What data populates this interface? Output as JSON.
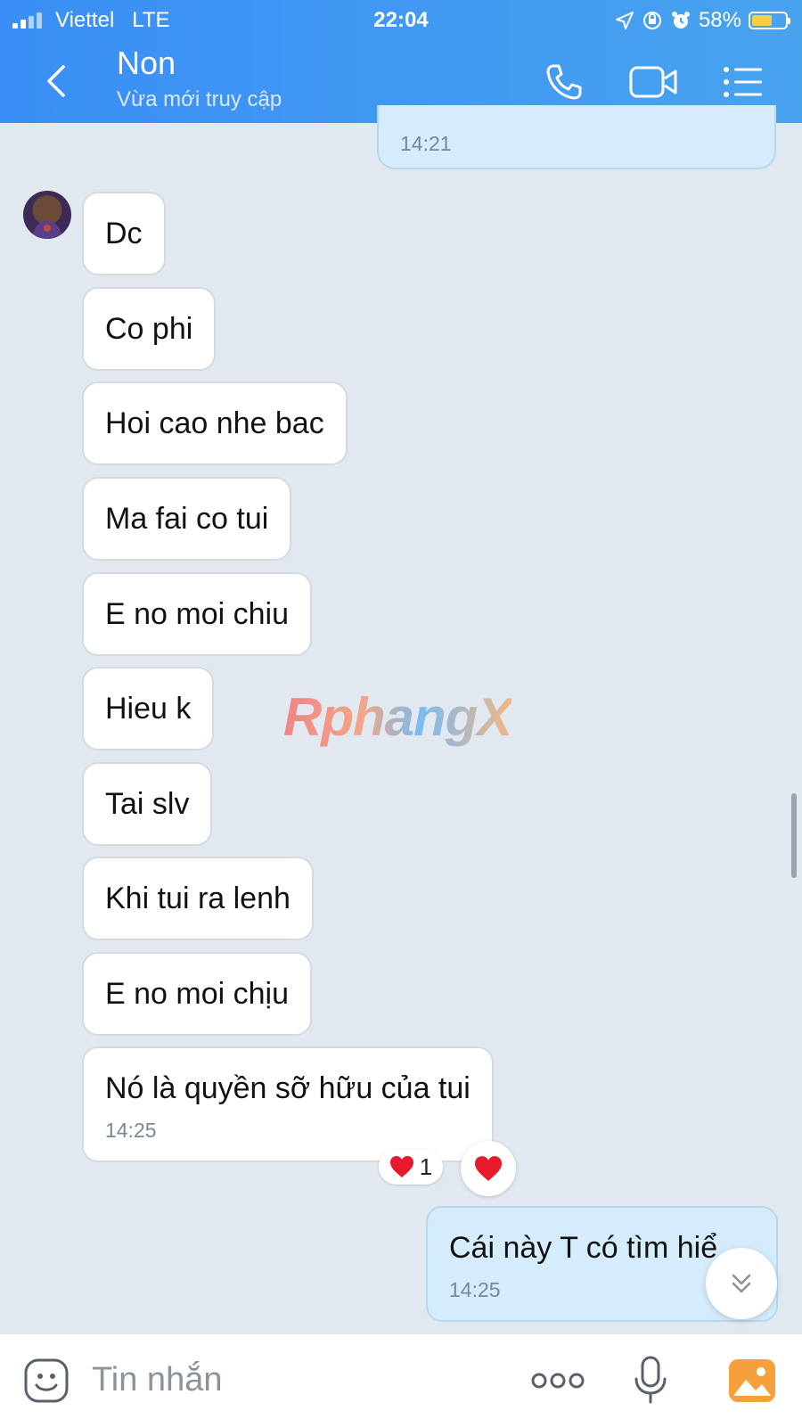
{
  "status_bar": {
    "carrier": "Viettel",
    "network": "LTE",
    "time": "22:04",
    "battery": "58%"
  },
  "header": {
    "contact_name": "Non",
    "contact_status": "Vừa mới truy cập",
    "icons": [
      "back-icon",
      "phone-icon",
      "video-icon",
      "menu-icon"
    ]
  },
  "chat": {
    "previous_outgoing_time": "14:21",
    "incoming": [
      {
        "text": "Dc"
      },
      {
        "text": "Co phi"
      },
      {
        "text": "Hoi cao nhe bac"
      },
      {
        "text": "Ma fai co tui"
      },
      {
        "text": "E no moi chiu"
      },
      {
        "text": "Hieu k"
      },
      {
        "text": "Tai slv"
      },
      {
        "text": "Khi tui ra lenh"
      },
      {
        "text": "E no moi chịu"
      },
      {
        "text": "Nó là quyền sỡ hữu của tui",
        "time": "14:25"
      }
    ],
    "reaction": {
      "icon": "heart-icon",
      "count": "1"
    },
    "outgoing": {
      "text": "Cái này T có tìm hiể",
      "time": "14:25"
    }
  },
  "watermark": "RphangX",
  "input_bar": {
    "placeholder": "Tin nhắn",
    "icons": [
      "sticker-icon",
      "more-icon",
      "microphone-icon",
      "image-icon"
    ]
  },
  "colors": {
    "header_start": "#3a8ef5",
    "header_end": "#48a3ef",
    "chat_bg": "#e2e8f0",
    "outgoing_bubble": "#d4ecfb",
    "incoming_bubble": "#ffffff",
    "heart": "#e8192c"
  }
}
